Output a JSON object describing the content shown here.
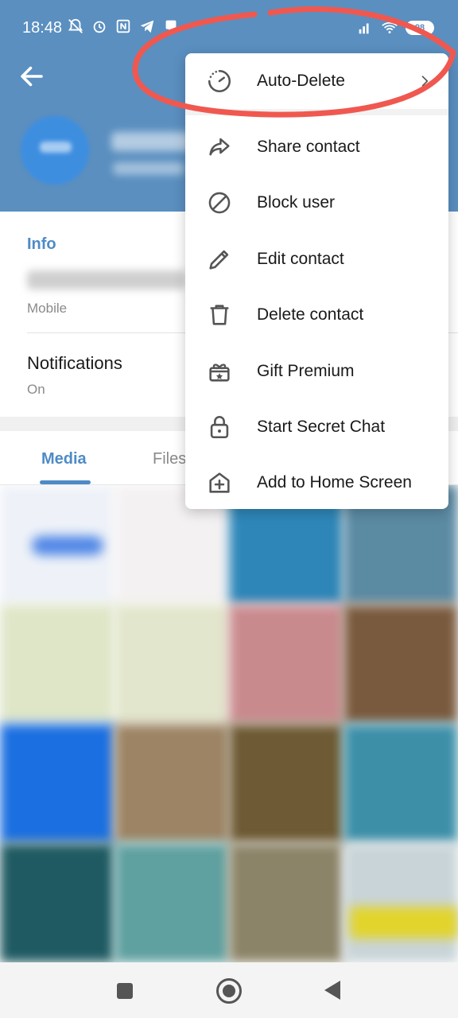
{
  "status_bar": {
    "time": "18:48",
    "battery": "98"
  },
  "header": {
    "back_icon": "arrow-left-icon"
  },
  "info": {
    "title": "Info",
    "phone_label": "Mobile",
    "notifications_label": "Notifications",
    "notifications_value": "On"
  },
  "tabs": [
    {
      "label": "Media"
    },
    {
      "label": "Files"
    }
  ],
  "menu": {
    "items": [
      {
        "label": "Auto-Delete",
        "icon": "timer-icon"
      },
      {
        "label": "Share contact",
        "icon": "share-icon"
      },
      {
        "label": "Block user",
        "icon": "block-icon"
      },
      {
        "label": "Edit contact",
        "icon": "pencil-icon"
      },
      {
        "label": "Delete contact",
        "icon": "trash-icon"
      },
      {
        "label": "Gift Premium",
        "icon": "gift-icon"
      },
      {
        "label": "Start Secret Chat",
        "icon": "lock-icon"
      },
      {
        "label": "Add to Home Screen",
        "icon": "add-home-icon"
      }
    ]
  },
  "colors": {
    "header_bg": "#5a8fc0",
    "accent": "#4e8bc6",
    "annotation": "#f0584f"
  }
}
